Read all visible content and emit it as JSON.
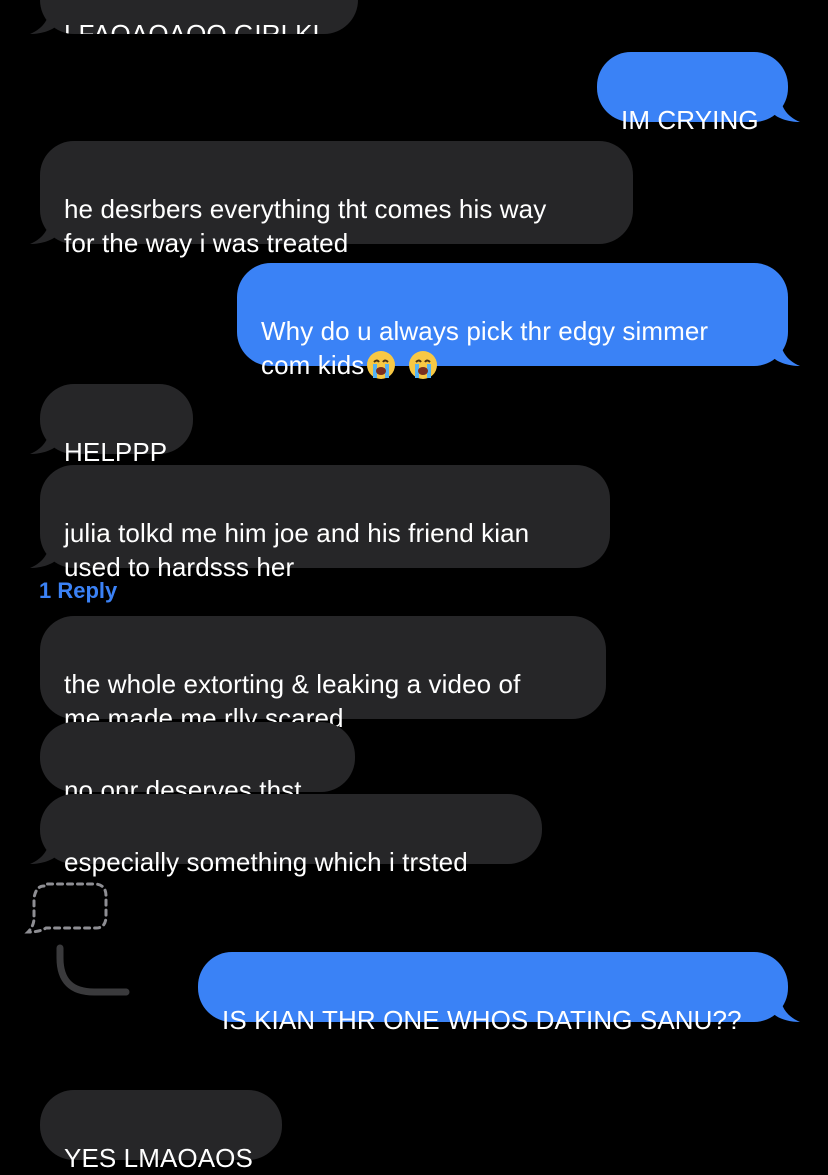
{
  "colors": {
    "background": "#000000",
    "incoming_bubble": "#262628",
    "outgoing_bubble": "#3a82f6",
    "reply_link": "#3b82f6"
  },
  "messages": [
    {
      "id": "m0",
      "direction": "incoming",
      "text": "LFAOAOAOO GIRLKL"
    },
    {
      "id": "m1",
      "direction": "outgoing",
      "text": "IM CRYING"
    },
    {
      "id": "m2",
      "direction": "incoming",
      "text": "he desrbers everything tht comes his way\nfor the way i was treated"
    },
    {
      "id": "m3",
      "direction": "outgoing",
      "text": "Why do u always pick thr edgy simmer\ncom kids",
      "emoji": [
        "loudly-crying-face-emoji",
        "loudly-crying-face-emoji"
      ]
    },
    {
      "id": "m4",
      "direction": "incoming",
      "text": "HELPPP"
    },
    {
      "id": "m5",
      "direction": "incoming",
      "text": "julia tolkd me him joe and his friend kian\nused to hardsss her"
    },
    {
      "id": "m6",
      "direction": "incoming",
      "text": "the whole extorting & leaking a video of\nme made me rlly scared"
    },
    {
      "id": "m7",
      "direction": "incoming",
      "text": "no onr deserves thst"
    },
    {
      "id": "m8",
      "direction": "incoming",
      "text": "especially something which i trsted"
    },
    {
      "id": "m9",
      "direction": "outgoing",
      "text": "IS KIAN THR ONE WHOS DATING SANU??"
    },
    {
      "id": "m10",
      "direction": "incoming",
      "text": "YES LMAOAOS"
    }
  ],
  "reply_link": "1 Reply",
  "icons": {
    "thread": "dashed-thought-bubble-reply-icon"
  }
}
